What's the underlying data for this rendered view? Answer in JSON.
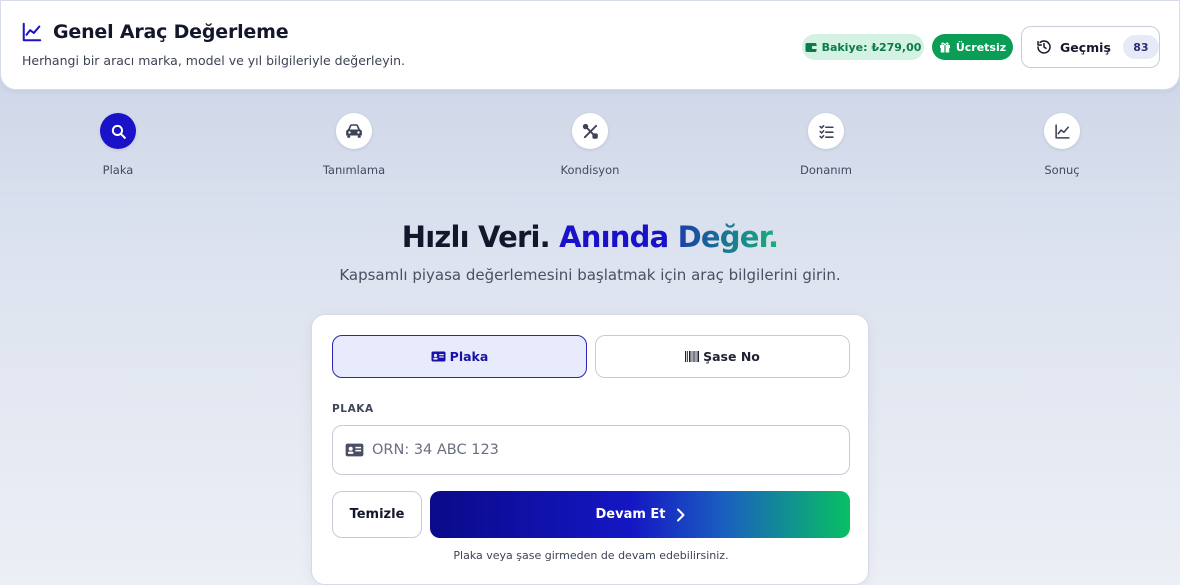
{
  "header": {
    "title": "Genel Araç Değerleme",
    "subtitle": "Herhangi bir aracı marka, model ve yıl bilgileriyle değerleyin.",
    "balance_label": "Bakiye: ₺279,00",
    "free_label": "Ücretsiz",
    "history_label": "Geçmiş",
    "history_count": "83",
    "icons": {
      "title": "chart-line-icon",
      "balance": "wallet-icon",
      "free": "gift-icon",
      "history": "history-icon"
    }
  },
  "steps": [
    {
      "label": "Plaka",
      "icon": "search-icon",
      "active": true
    },
    {
      "label": "Tanımlama",
      "icon": "car-icon",
      "active": false
    },
    {
      "label": "Kondisyon",
      "icon": "tools-icon",
      "active": false
    },
    {
      "label": "Donanım",
      "icon": "checklist-icon",
      "active": false
    },
    {
      "label": "Sonuç",
      "icon": "chart-line-icon",
      "active": false
    }
  ],
  "hero": {
    "title_part1": "Hızlı Veri.",
    "title_part2": "Anında",
    "title_part3": "Değer.",
    "subtitle": "Kapsamlı piyasa değerlemesini başlatmak için araç bilgilerini girin."
  },
  "form": {
    "tabs": [
      {
        "label": "Plaka",
        "icon": "id-card-icon",
        "active": true
      },
      {
        "label": "Şase No",
        "icon": "barcode-icon",
        "active": false
      }
    ],
    "field_label": "PLAKA",
    "input_placeholder": "ÖRN: 34 ABC 123",
    "input_value": "",
    "clear_label": "Temizle",
    "continue_label": "Devam Et",
    "hint": "Plaka veya şase girmeden de devam edebilirsiniz."
  },
  "colors": {
    "primary": "#1a12c9",
    "accent_green": "#0a9d55",
    "balance_bg": "#d3f2e3"
  }
}
